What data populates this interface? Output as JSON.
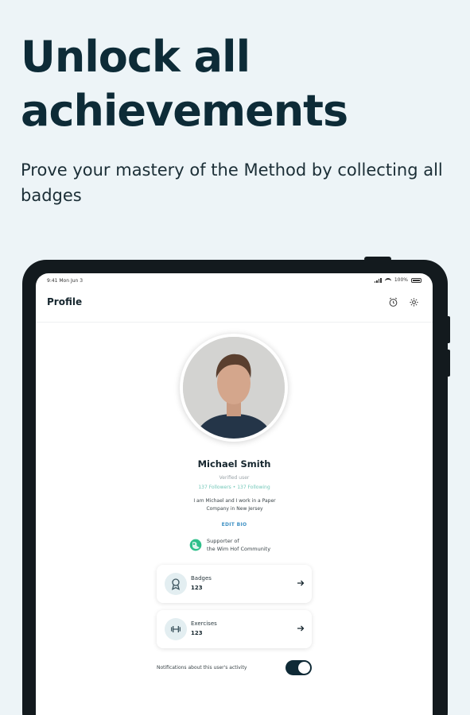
{
  "hero": {
    "title_line1": "Unlock all",
    "title_line2": "achievements",
    "subtitle": "Prove your mastery of the Method by collecting all badges"
  },
  "status_bar": {
    "time": "9:41 Mon Jun 3",
    "battery": "100%"
  },
  "app_bar": {
    "title": "Profile"
  },
  "profile": {
    "name": "Michael Smith",
    "verified": "Verified user",
    "followers": "137 Followers",
    "separator": "•",
    "following": "137 Following",
    "bio": "I am Michael and I work in a Paper Company in New Jersey",
    "edit_bio": "EDIT BIO",
    "supporter_line1": "Supporter of",
    "supporter_line2": "the Wim Hof Community"
  },
  "cards": {
    "badges": {
      "label": "Badges",
      "count": "123",
      "icon": "badge-icon"
    },
    "exercises": {
      "label": "Exercises",
      "count": "123",
      "icon": "dumbbell-icon"
    }
  },
  "notifications": {
    "label": "Notifications about this user's activity",
    "enabled": true
  },
  "colors": {
    "background": "#edf4f7",
    "primary": "#0f2a36",
    "follow_link": "#72c7b8",
    "edit_link": "#3f91c4"
  }
}
